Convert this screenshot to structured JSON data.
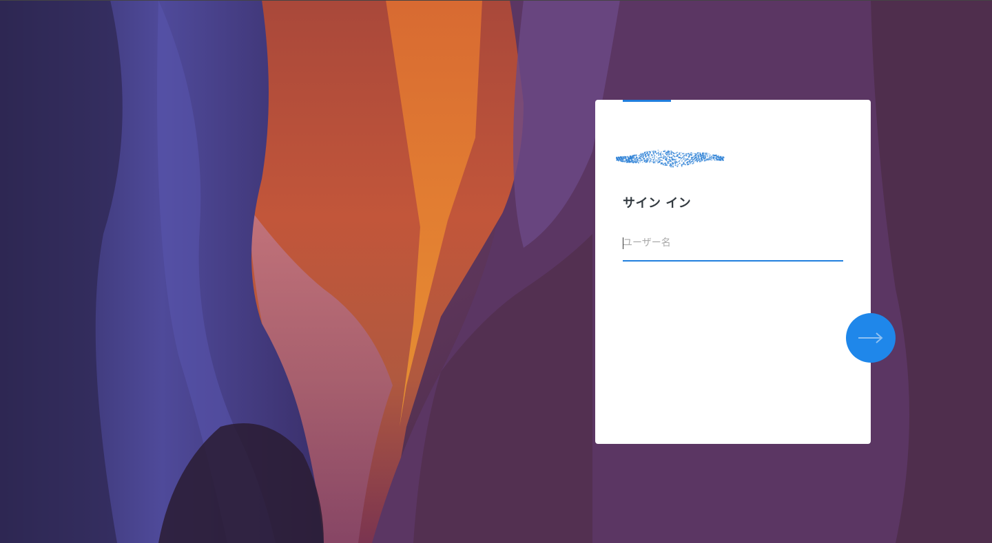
{
  "login": {
    "title": "サイン イン",
    "username_placeholder": "ユーザー名",
    "username_value": ""
  },
  "icons": {
    "next": "arrow-right-icon",
    "logo": "obscured-logo"
  },
  "colors": {
    "accent": "#1f87ea",
    "underline": "#1f7ede",
    "card_background": "#ffffff",
    "title_text": "#333a40"
  }
}
